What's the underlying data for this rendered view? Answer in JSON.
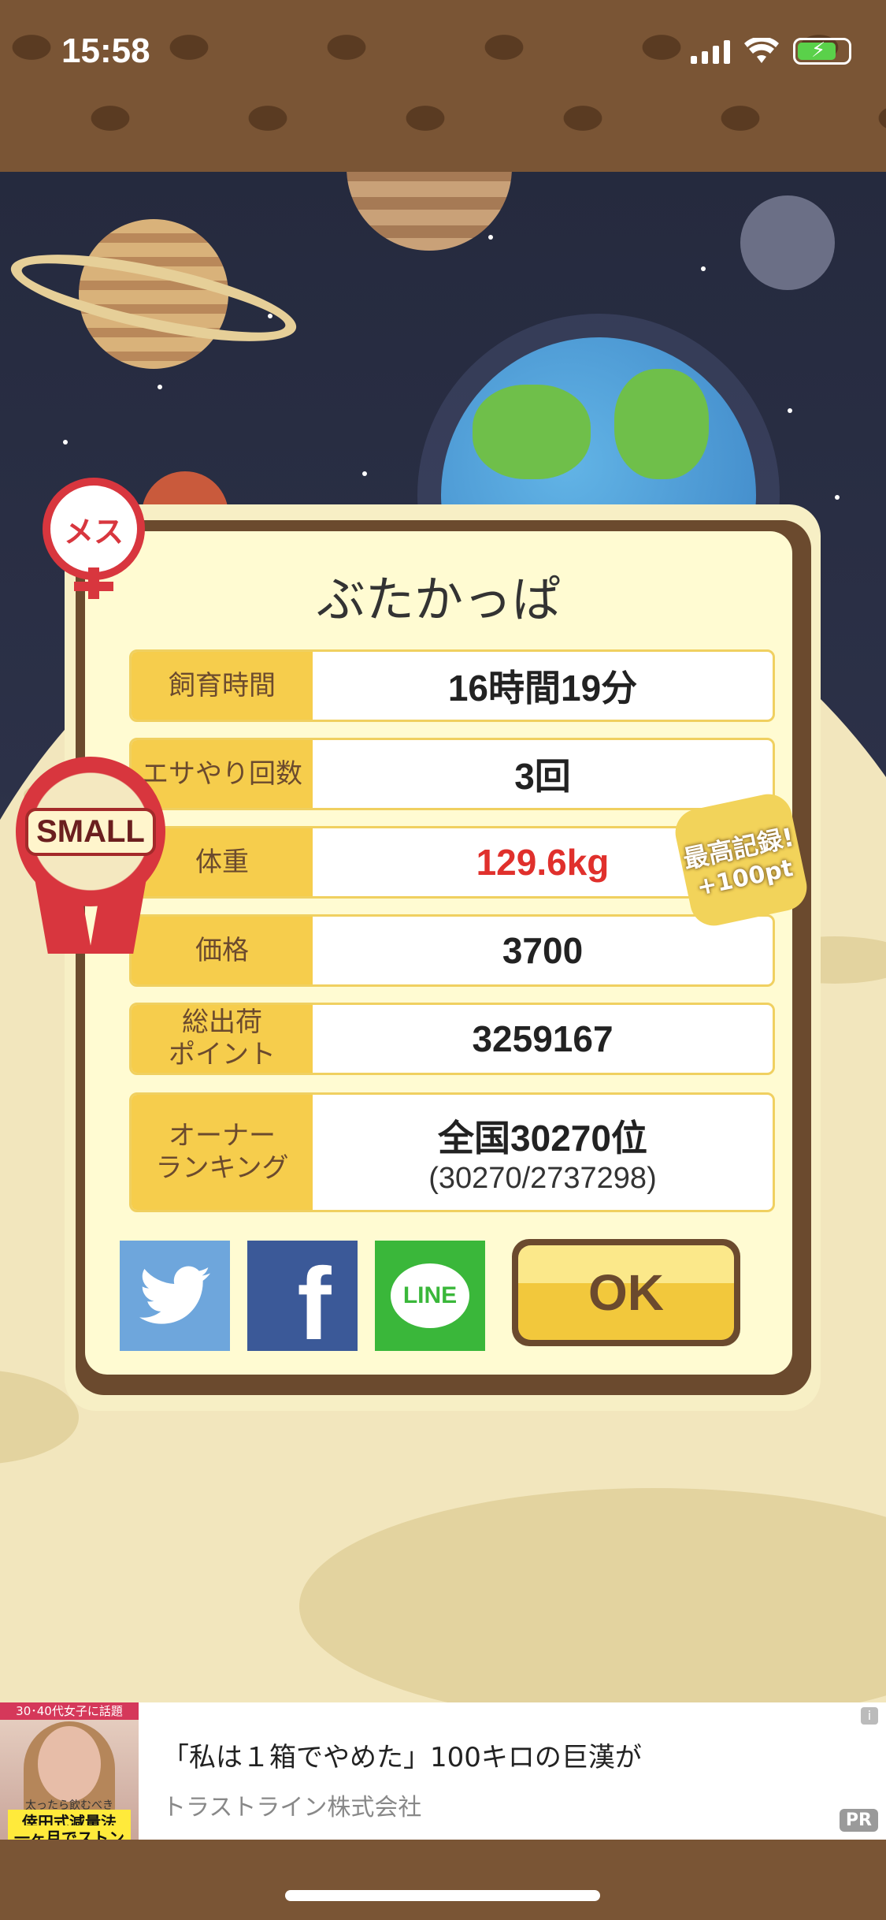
{
  "status_bar": {
    "time": "15:58"
  },
  "card": {
    "title": "ぶたかっぱ",
    "rows": [
      {
        "label": "飼育時間",
        "value": "16時間19分"
      },
      {
        "label": "エサやり回数",
        "value": "3回"
      },
      {
        "label": "体重",
        "value": "129.6kg",
        "value_color": "#e0302c"
      },
      {
        "label": "価格",
        "value": "3700"
      },
      {
        "label": "総出荷\nポイント",
        "value": "3259167"
      },
      {
        "label": "オーナー\nランキング",
        "value": "全国30270位",
        "sub": "(30270/2737298)"
      }
    ],
    "share": {
      "twitter": {
        "color": "#6ea6dc"
      },
      "facebook": {
        "color": "#3b5998",
        "glyph": "f"
      },
      "line": {
        "color": "#3ab73a",
        "text": "LINE"
      }
    },
    "ok_label": "OK"
  },
  "badges": {
    "gender": "メス",
    "size": "SMALL",
    "record_line1": "最高記録!",
    "record_line2": "+100pt"
  },
  "ad": {
    "thumb_tag": "30･40代女子に話題",
    "thumb_small": "太ったら飲むべき",
    "thumb_line1": "倖田式減量法",
    "thumb_line2": "一ヶ月でストン",
    "title": "「私は１箱でやめた」100キロの巨漢が",
    "sponsor": "トラストライン株式会社",
    "pr": "PR",
    "info": "i"
  }
}
